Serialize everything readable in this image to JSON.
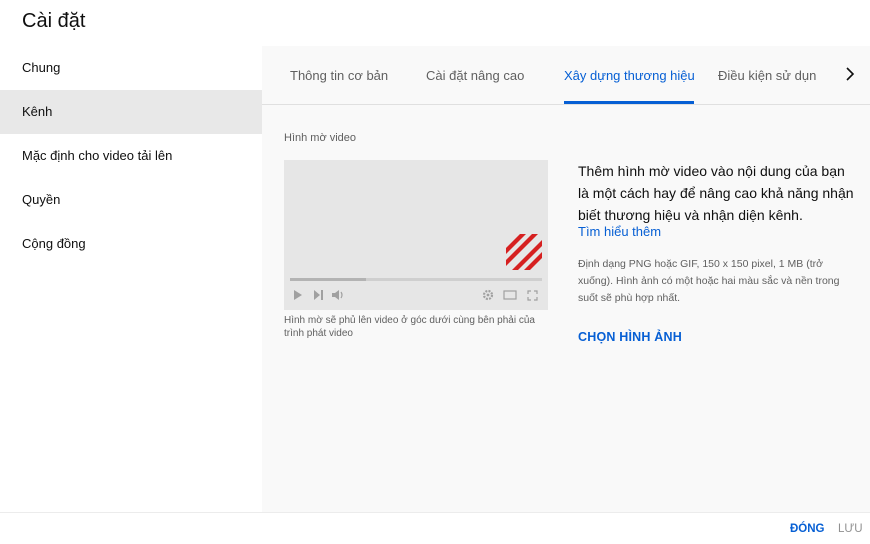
{
  "page": {
    "title": "Cài đặt"
  },
  "sidebar": {
    "items": [
      {
        "label": "Chung"
      },
      {
        "label": "Kênh"
      },
      {
        "label": "Mặc định cho video tải lên"
      },
      {
        "label": "Quyền"
      },
      {
        "label": "Cộng đồng"
      }
    ],
    "active_index": 1
  },
  "tabs": {
    "items": [
      {
        "label": "Thông tin cơ bản"
      },
      {
        "label": "Cài đặt nâng cao"
      },
      {
        "label": "Xây dựng thương hiệu"
      },
      {
        "label": "Điều kiện sử dụn"
      }
    ],
    "active_index": 2,
    "next_icon": "chevron-right-icon"
  },
  "watermark": {
    "section_label": "Hình mờ video",
    "player_caption": "Hình mờ sẽ phủ lên video ở góc dưới cùng bên phải của trình phát video",
    "progress_fraction": 0.3,
    "player_icons": [
      "play-icon",
      "next-icon",
      "volume-icon",
      "settings-icon",
      "theater-mode-icon",
      "fullscreen-icon"
    ],
    "watermark_color": "#d62020"
  },
  "info": {
    "heading": "Thêm hình mờ video vào nội dung của bạn là một cách hay để nâng cao khả năng nhận biết thương hiệu và nhận diện kênh.",
    "learn_more": "Tìm hiểu thêm",
    "format_note": "Định dạng PNG hoặc GIF, 150 x 150 pixel, 1 MB (trở xuống). Hình ảnh có một hoặc hai màu sắc và nền trong suốt sẽ phù hợp nhất.",
    "choose_button": "CHỌN HÌNH ẢNH"
  },
  "footer": {
    "close_button": "ĐÓNG",
    "save_button": "LƯU"
  },
  "colors": {
    "accent": "#065fd4",
    "sidebar_active": "#e8e8e8",
    "panel_bg": "#f9f9f9"
  }
}
